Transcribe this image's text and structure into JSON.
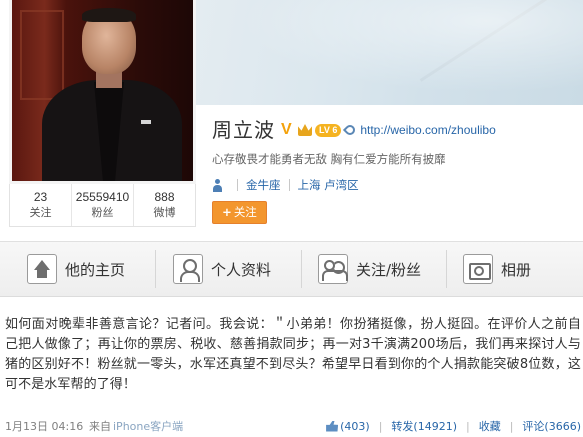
{
  "profile": {
    "name": "周立波",
    "verify_mark": "V",
    "level_badge": "LV 6",
    "url": "http://weibo.com/zhoulibo",
    "motto": "心存敬畏才能勇者无敌 胸有仁爱方能所有披靡",
    "zodiac": "金牛座",
    "location": "上海 卢湾区",
    "follow_label": "关注",
    "follow_plus": "+",
    "stats": [
      {
        "value": "23",
        "label": "关注"
      },
      {
        "value": "25559410",
        "label": "粉丝"
      },
      {
        "value": "888",
        "label": "微博"
      }
    ]
  },
  "tabs": [
    {
      "label": "他的主页",
      "icon": "home-icon"
    },
    {
      "label": "个人资料",
      "icon": "person-icon"
    },
    {
      "label": "关注/粉丝",
      "icon": "people-icon"
    },
    {
      "label": "相册",
      "icon": "camera-icon"
    }
  ],
  "post": {
    "text": "如何面对晚辈非善意言论？记者问。我会说：＂小弟弟！你扮猪挺像，扮人挺囧。在评价人之前自己把人做像了；再让你的票房、税收、慈善捐款同步；再一对3千演满200场后，我们再来探讨人与猪的区别好不！粉丝就一零头，水军还真望不到尽头？希望早日看到你的个人捐款能突破8位数，这可不是水军帮的了得！",
    "time": "1月13日 04:16",
    "source_prefix": "来自",
    "source": "iPhone客户端",
    "likes": "(403)",
    "repost": "转发(14921)",
    "favorite": "收藏",
    "comment": "评论(3666)",
    "separator": "|"
  },
  "colors": {
    "link": "#2866a8",
    "follow_button": "#f3962e",
    "verify": "#f4a20c"
  }
}
